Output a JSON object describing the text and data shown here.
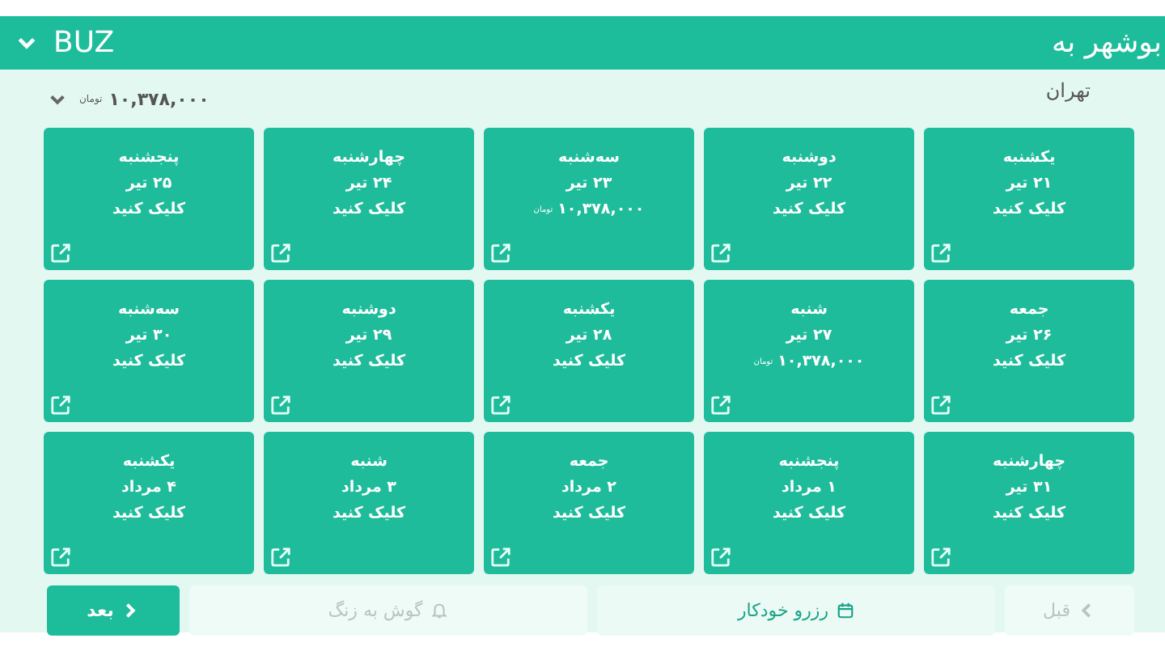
{
  "header": {
    "title": "بوشهر به",
    "code": "BUZ",
    "expanded": true
  },
  "subheader": {
    "city": "تهران",
    "price": "۱۰,۳۷۸,۰۰۰",
    "currency": "تومان"
  },
  "days": [
    {
      "day": "یکشنبه",
      "date": "۲۱ تیر",
      "kind": "link",
      "label": "کلیک کنید"
    },
    {
      "day": "دوشنبه",
      "date": "۲۲ تیر",
      "kind": "link",
      "label": "کلیک کنید"
    },
    {
      "day": "سه‌شنبه",
      "date": "۲۳ تیر",
      "kind": "price",
      "price": "۱۰,۳۷۸,۰۰۰",
      "currency": "تومان"
    },
    {
      "day": "چهارشنبه",
      "date": "۲۴ تیر",
      "kind": "link",
      "label": "کلیک کنید"
    },
    {
      "day": "پنجشنبه",
      "date": "۲۵ تیر",
      "kind": "link",
      "label": "کلیک کنید"
    },
    {
      "day": "جمعه",
      "date": "۲۶ تیر",
      "kind": "link",
      "label": "کلیک کنید"
    },
    {
      "day": "شنبه",
      "date": "۲۷ تیر",
      "kind": "price",
      "price": "۱۰,۳۷۸,۰۰۰",
      "currency": "تومان"
    },
    {
      "day": "یکشنبه",
      "date": "۲۸ تیر",
      "kind": "link",
      "label": "کلیک کنید"
    },
    {
      "day": "دوشنبه",
      "date": "۲۹ تیر",
      "kind": "link",
      "label": "کلیک کنید"
    },
    {
      "day": "سه‌شنبه",
      "date": "۳۰ تیر",
      "kind": "link",
      "label": "کلیک کنید"
    },
    {
      "day": "چهارشنبه",
      "date": "۳۱ تیر",
      "kind": "link",
      "label": "کلیک کنید"
    },
    {
      "day": "پنجشنبه",
      "date": "۱ مرداد",
      "kind": "link",
      "label": "کلیک کنید"
    },
    {
      "day": "جمعه",
      "date": "۲ مرداد",
      "kind": "link",
      "label": "کلیک کنید"
    },
    {
      "day": "شنبه",
      "date": "۳ مرداد",
      "kind": "link",
      "label": "کلیک کنید"
    },
    {
      "day": "یکشنبه",
      "date": "۴ مرداد",
      "kind": "link",
      "label": "کلیک کنید"
    }
  ],
  "buttons": [
    {
      "label": "قبل",
      "kind": "prev",
      "disabled": true
    },
    {
      "label": "رزرو خودکار",
      "kind": "auto",
      "disabled": false
    },
    {
      "label": "گوش به زنگ",
      "kind": "alert",
      "disabled": true
    },
    {
      "label": "بعد",
      "kind": "next",
      "disabled": false
    }
  ]
}
